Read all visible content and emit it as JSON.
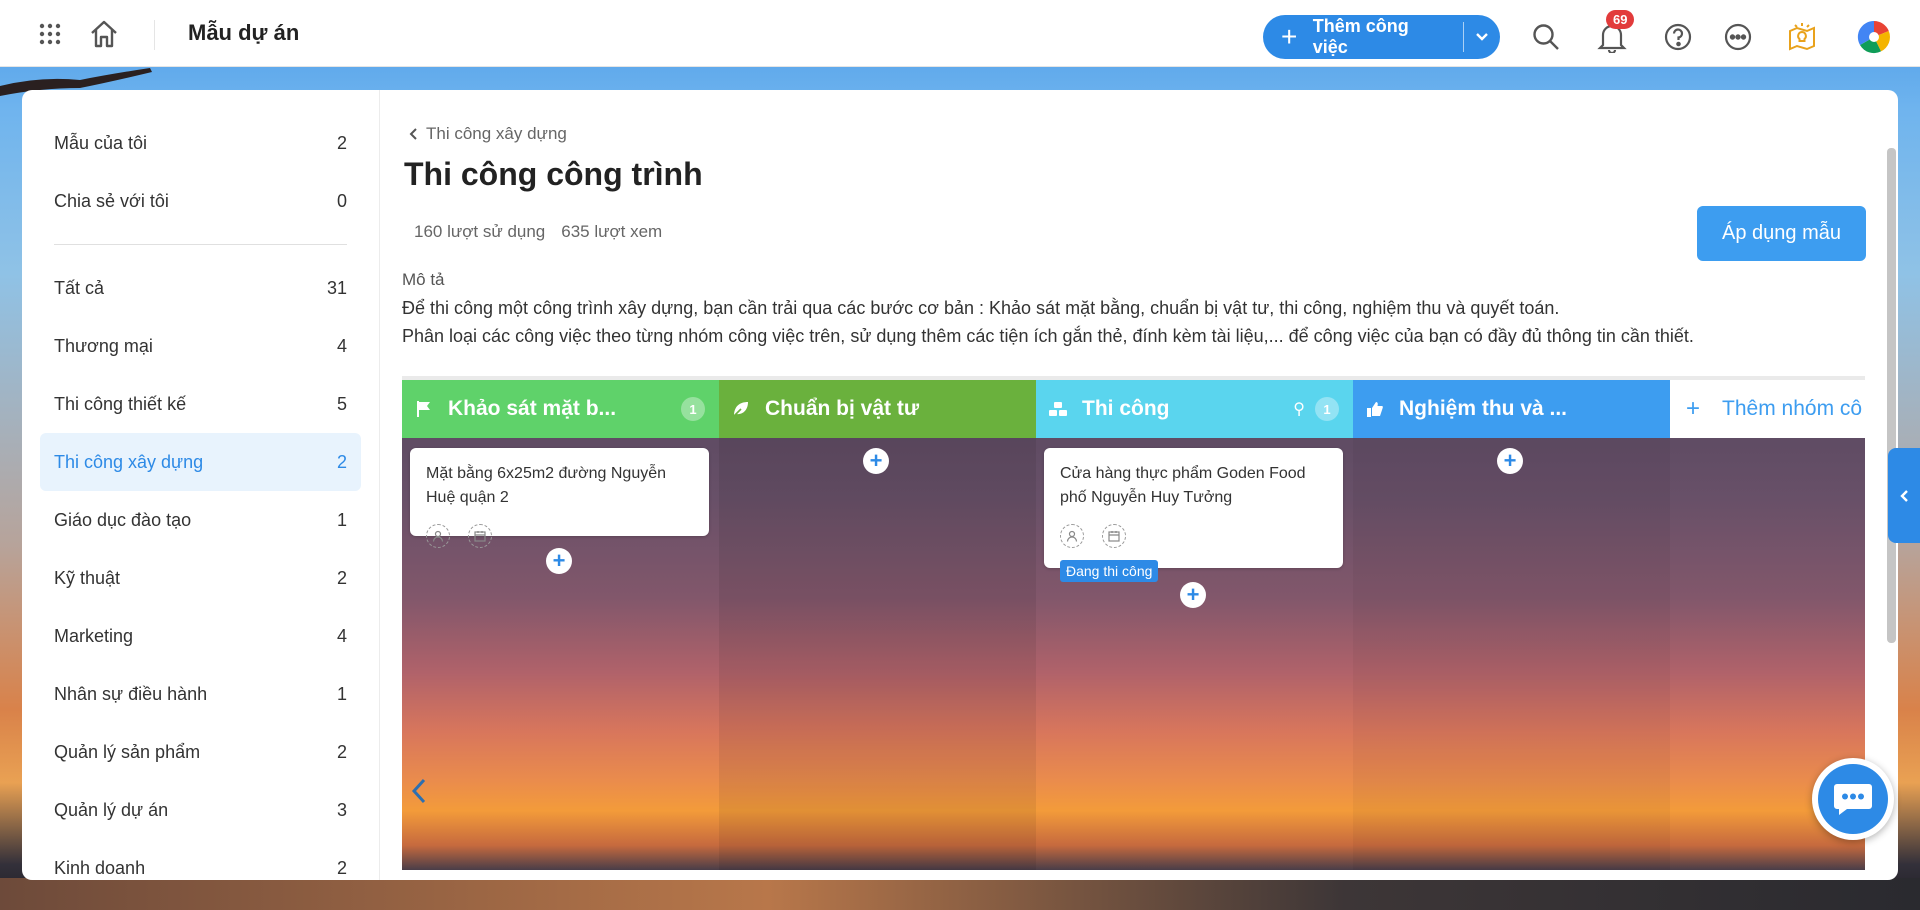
{
  "header": {
    "app_title": "Mẫu dự án",
    "add_task_label": "Thêm công việc",
    "notification_count": "69"
  },
  "sidebar": {
    "top_items": [
      {
        "label": "Mẫu của tôi",
        "count": "2"
      },
      {
        "label": "Chia sẻ với tôi",
        "count": "0"
      }
    ],
    "categories": [
      {
        "label": "Tất cả",
        "count": "31"
      },
      {
        "label": "Thương mại",
        "count": "4"
      },
      {
        "label": "Thi công thiết kế",
        "count": "5"
      },
      {
        "label": "Thi công xây dựng",
        "count": "2",
        "active": true
      },
      {
        "label": "Giáo dục đào tạo",
        "count": "1"
      },
      {
        "label": "Kỹ thuật",
        "count": "2"
      },
      {
        "label": "Marketing",
        "count": "4"
      },
      {
        "label": "Nhân sự điều hành",
        "count": "1"
      },
      {
        "label": "Quản lý sản phẩm",
        "count": "2"
      },
      {
        "label": "Quản lý dự án",
        "count": "3"
      },
      {
        "label": "Kinh doanh",
        "count": "2"
      }
    ]
  },
  "main": {
    "breadcrumb": "Thi công xây dựng",
    "title": "Thi công công trình",
    "uses": "160 lượt sử dụng",
    "views": "635 lượt xem",
    "apply_label": "Áp dụng mẫu",
    "description_label": "Mô tả",
    "description_line1": "Để thi công một công trình xây dựng, bạn cần trải qua các bước cơ bản : Khảo sát mặt bằng, chuẩn bị vật tư, thi công, nghiệm thu và quyết toán.",
    "description_line2": "Phân loại các công việc theo từng nhóm công việc trên, sử dụng thêm các tiện ích gắn thẻ, đính kèm tài liệu,... để công việc của bạn có đầy đủ thông tin cần thiết."
  },
  "board": {
    "columns": [
      {
        "title": "Khảo sát mặt b...",
        "count": "1",
        "icon": "flag-icon",
        "color": "#5fd26a"
      },
      {
        "title": "Chuẩn bị vật tư",
        "icon": "leaf-icon",
        "color": "#6ab13d"
      },
      {
        "title": "Thi công",
        "count": "1",
        "icon": "blocks-icon",
        "color": "#5ad5ee"
      },
      {
        "title": "Nghiệm thu và ...",
        "icon": "thumbs-up-icon",
        "color": "#3d9df0"
      }
    ],
    "add_group_label": "Thêm nhóm cô",
    "cards": [
      {
        "title_line1": "Mặt bằng 6x25m2 đường Nguyễn",
        "title_line2": "Huệ quận 2"
      },
      {
        "title_line1": "Cửa hàng thực phẩm Goden Food",
        "title_line2": "phố Nguyễn Huy Tưởng",
        "tag": "Đang thi công"
      }
    ]
  },
  "colors": {
    "accent": "#2d8ae6",
    "badge": "#e23b3b"
  }
}
